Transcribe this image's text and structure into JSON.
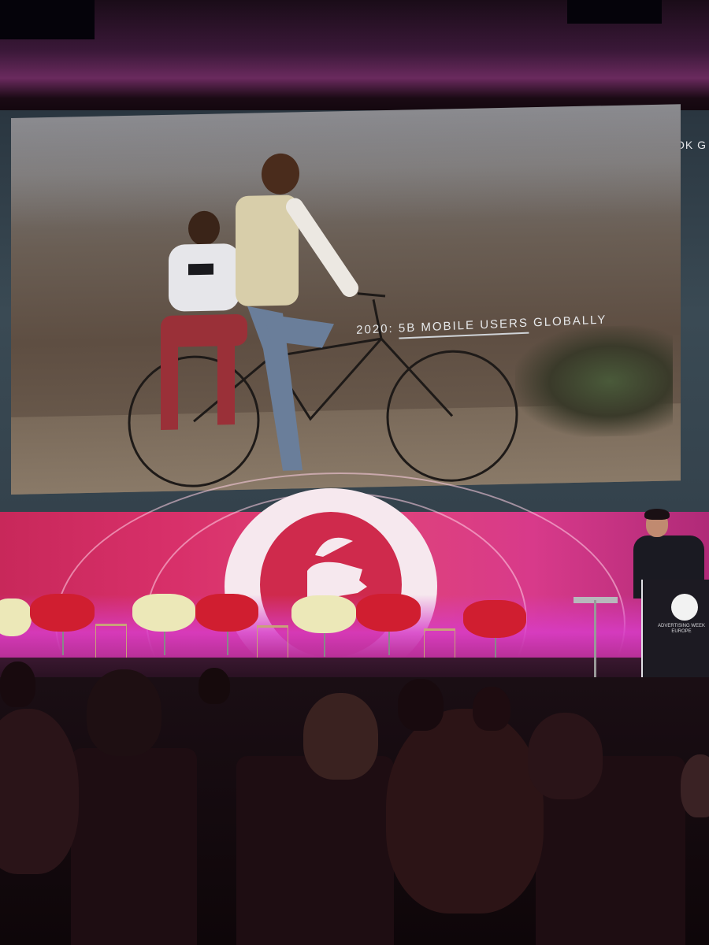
{
  "slide": {
    "headline_prefix": "2020: ",
    "headline_emphasis": "5B MOBILE USERS",
    "headline_suffix": " GLOBALLY"
  },
  "side_screen": {
    "text": "\"OK G"
  },
  "podium": {
    "brand_text": "ADVERTISING WEEK EUROPE"
  },
  "colors": {
    "stage_pink": "#d8306a",
    "stage_magenta": "#c83aa8",
    "logo_red": "#cf2a4c",
    "logo_white": "#f6e8ee",
    "chair_red": "#d01e30",
    "chair_cream": "#ece8b8"
  },
  "icons": [
    "event-logo-icon",
    "podium-logo-icon"
  ]
}
